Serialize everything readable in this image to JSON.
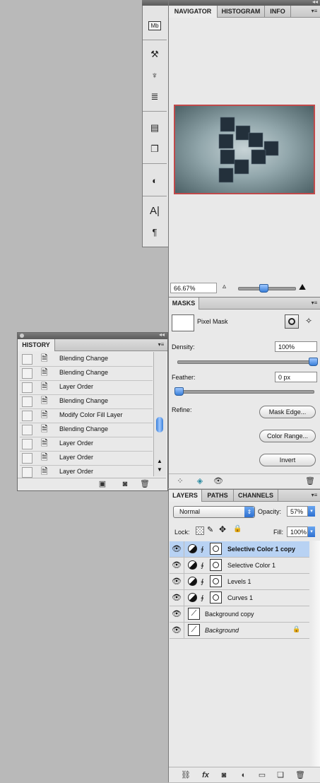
{
  "toolbar": {
    "icons": [
      "mini-bridge-icon",
      "tool-presets-icon",
      "clone-source-icon",
      "brush-presets-icon",
      "notes-icon",
      "layer-comps-icon",
      "adjustments-icon",
      "character-icon",
      "paragraph-icon"
    ],
    "mb_label": "Mb"
  },
  "navigator": {
    "tabs": [
      "NAVIGATOR",
      "HISTOGRAM",
      "INFO"
    ],
    "zoom": "66.67%"
  },
  "masks": {
    "tab": "MASKS",
    "title": "Pixel Mask",
    "density_label": "Density:",
    "density_value": "100%",
    "density_fraction": 1.0,
    "feather_label": "Feather:",
    "feather_value": "0 px",
    "feather_fraction": 0.0,
    "refine_label": "Refine:",
    "buttons": [
      "Mask Edge...",
      "Color Range...",
      "Invert"
    ]
  },
  "history": {
    "tab": "HISTORY",
    "items": [
      "Blending Change",
      "Blending Change",
      "Layer Order",
      "Blending Change",
      "Modify Color Fill Layer",
      "Blending Change",
      "Layer Order",
      "Layer Order",
      "Layer Order"
    ]
  },
  "layers": {
    "tabs": [
      "LAYERS",
      "PATHS",
      "CHANNELS"
    ],
    "blend_mode": "Normal",
    "opacity_label": "Opacity:",
    "opacity": "57%",
    "lock_label": "Lock:",
    "fill_label": "Fill:",
    "fill": "100%",
    "items": [
      {
        "name": "Selective Color 1 copy",
        "kind": "adjustment",
        "selected": true
      },
      {
        "name": "Selective Color 1",
        "kind": "adjustment",
        "selected": false
      },
      {
        "name": "Levels 1",
        "kind": "adjustment",
        "selected": false
      },
      {
        "name": "Curves 1",
        "kind": "adjustment",
        "selected": false
      },
      {
        "name": "Background copy",
        "kind": "pixel",
        "selected": false
      },
      {
        "name": "Background",
        "kind": "background",
        "selected": false
      }
    ]
  },
  "colors": {
    "selection": "#b8d2f3",
    "accent": "#3a7fd9",
    "navigator_frame": "#c0494a"
  }
}
